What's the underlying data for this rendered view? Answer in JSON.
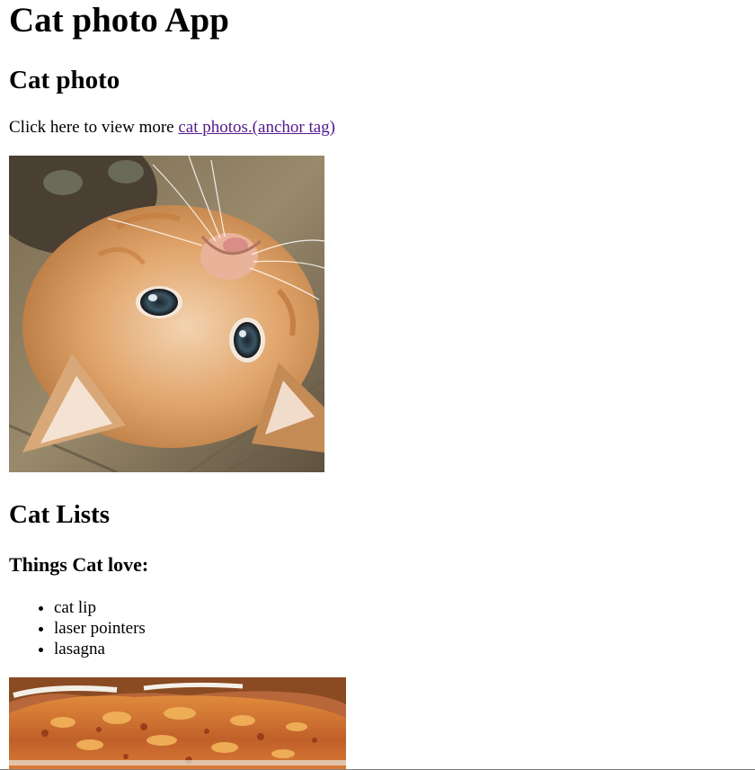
{
  "page": {
    "title": "Cat photo App",
    "section_photo_heading": "Cat photo",
    "intro_text": "Click here to view more ",
    "link_text": "cat photos.(anchor tag)",
    "section_lists_heading": "Cat Lists",
    "list_heading": "Things Cat love:",
    "list_items": [
      "cat lip",
      "laser pointers",
      "lasagna"
    ]
  },
  "images": {
    "cat_photo_alt": "cat photo",
    "lasagna_alt": "lasagna"
  },
  "colors": {
    "visited_link": "#551a8b",
    "text": "#000000",
    "background": "#ffffff"
  }
}
